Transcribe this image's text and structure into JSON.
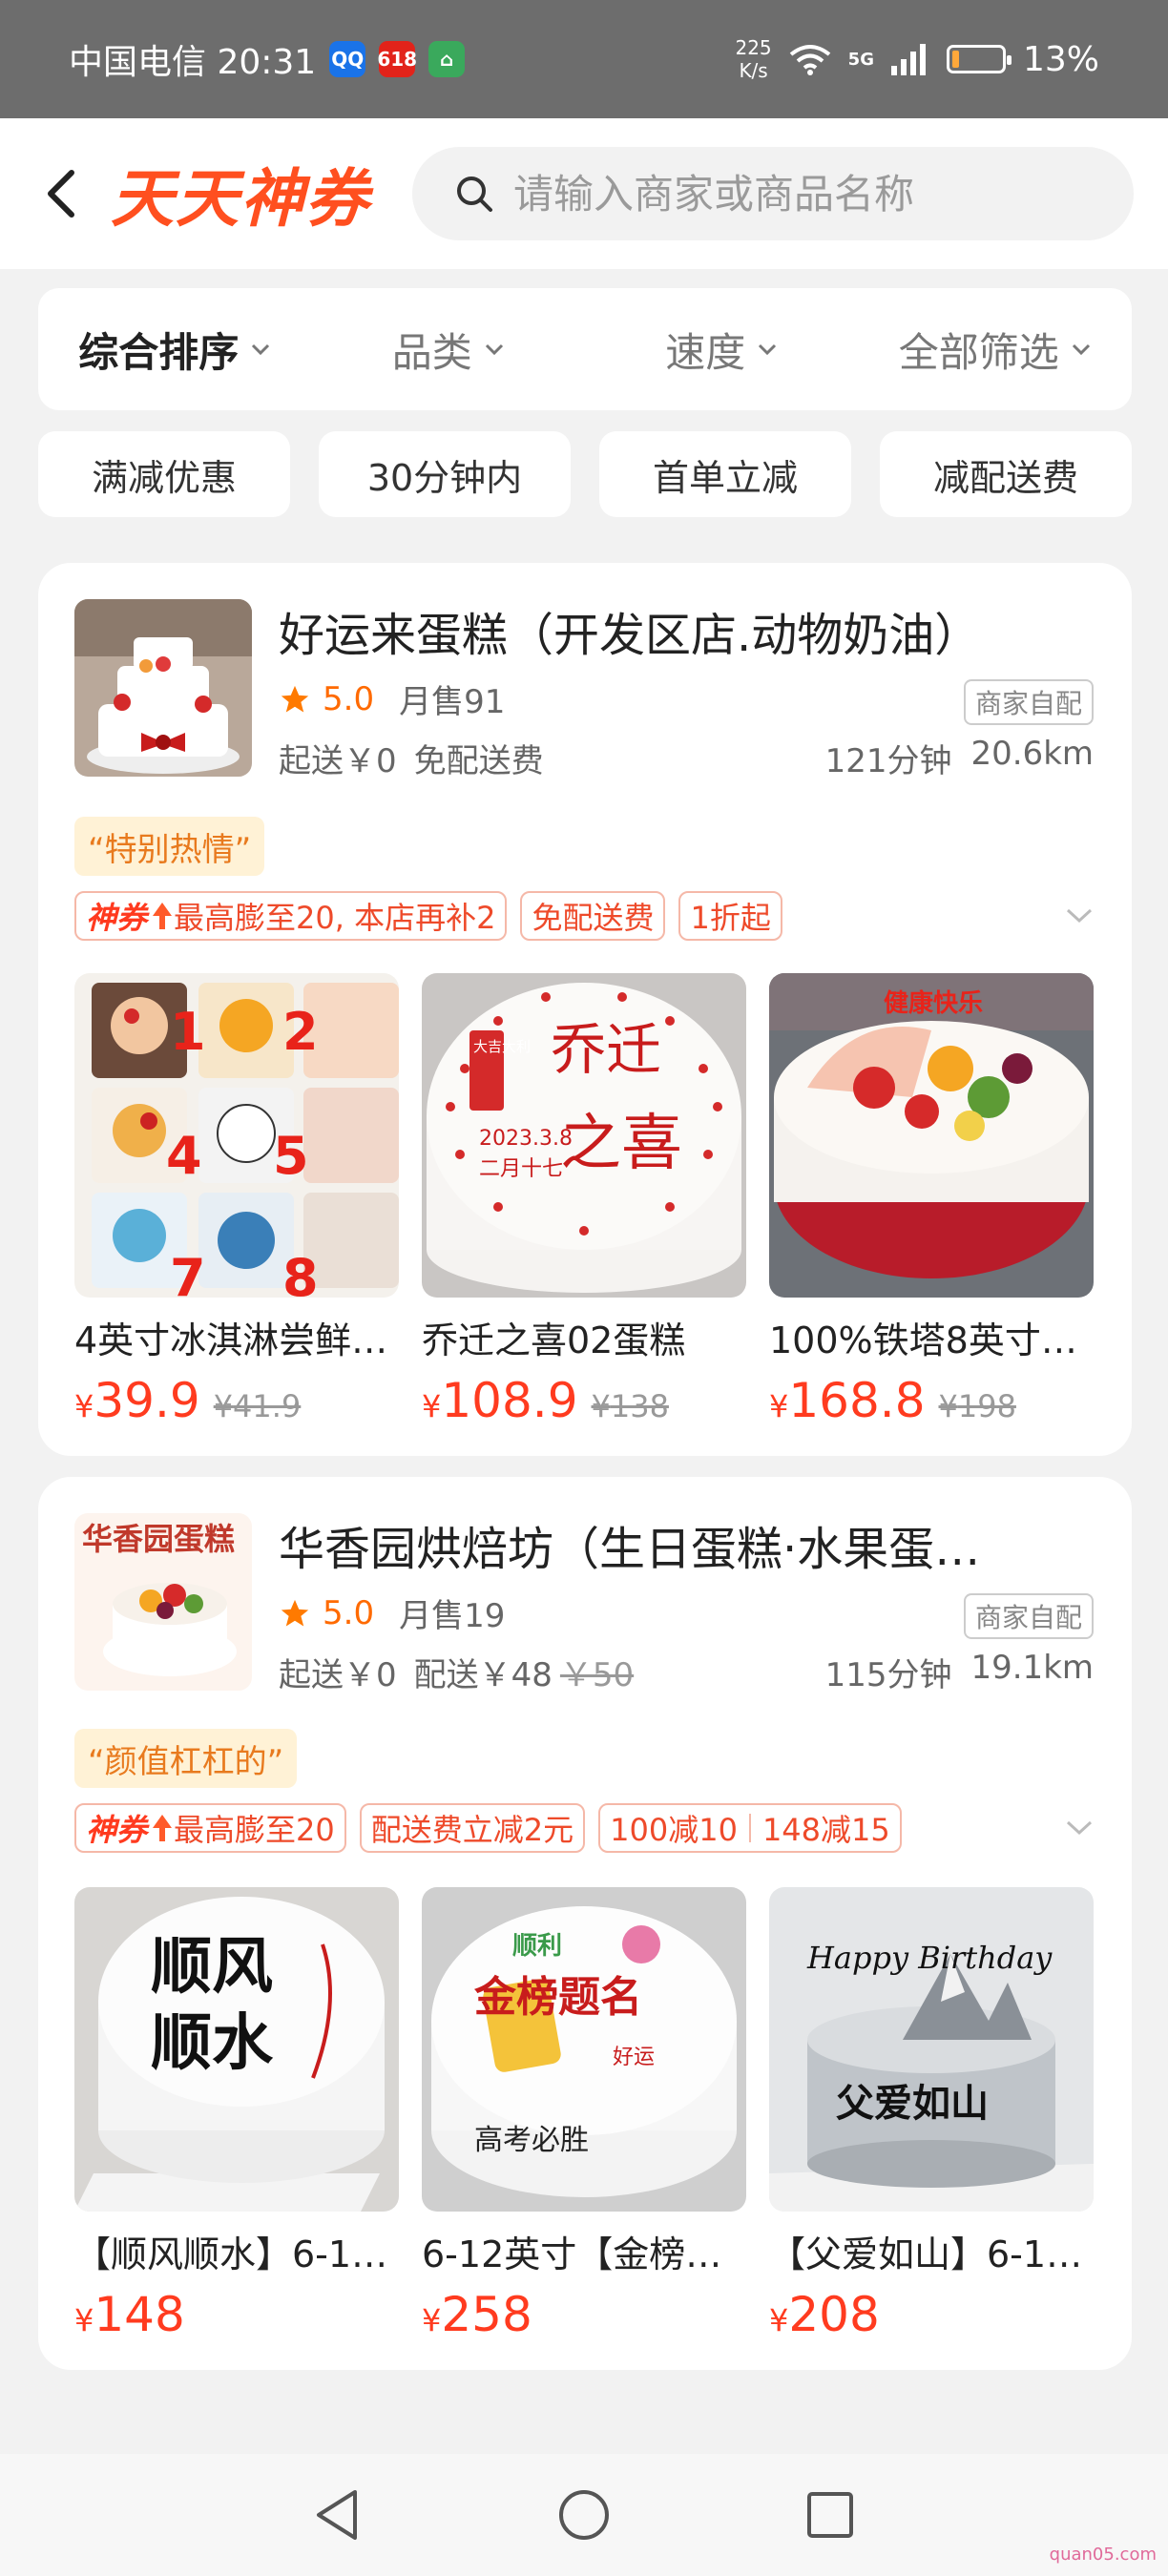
{
  "status": {
    "carrier_time": "中国电信 20:31",
    "net_speed": "225",
    "net_unit": "K/s",
    "network": "5G",
    "battery": "13%",
    "battery_level": 0.13,
    "app_icons": [
      "qq-icon",
      "taobao-618-icon",
      "home-app-icon"
    ],
    "app_icon_text": [
      "QQ",
      "618",
      "⌂"
    ]
  },
  "header": {
    "logo_text": "天天神券",
    "search_placeholder": "请输入商家或商品名称"
  },
  "sort_tabs": [
    {
      "label": "综合排序",
      "active": true
    },
    {
      "label": "品类",
      "active": false
    },
    {
      "label": "速度",
      "active": false
    },
    {
      "label": "全部筛选",
      "active": false
    }
  ],
  "filter_chips": [
    "满减优惠",
    "30分钟内",
    "首单立减",
    "减配送费"
  ],
  "shops": [
    {
      "name": "好运来蛋糕（开发区店.动物奶油）",
      "rating": "5.0",
      "sales": "月售91",
      "delivery_badge": "商家自配",
      "min_order": "起送￥0",
      "delivery_fee": "免配送费",
      "delivery_fee_old": "",
      "time": "121分钟",
      "distance": "20.6km",
      "review_tag": "“特别热情”",
      "promos": {
        "coupon_prefix": "神券",
        "coupon": "最高膨至20, 本店再补2",
        "tag2": "免配送费",
        "tag3": "1折起",
        "tag4": ""
      },
      "products": [
        {
          "name": "4英寸冰淇淋尝鲜…",
          "price": "39.9",
          "old_price": "41.9"
        },
        {
          "name": "乔迁之喜02蛋糕",
          "price": "108.9",
          "old_price": "138"
        },
        {
          "name": "100%铁塔8英寸…",
          "price": "168.8",
          "old_price": "198"
        }
      ],
      "image_texts": [
        "乔迁",
        "之喜",
        "大吉大利",
        "2023.3.8",
        "二月十七",
        "健康快乐"
      ]
    },
    {
      "name": "华香园烘焙坊（生日蛋糕·水果蛋…",
      "logo_text": "华香园蛋糕",
      "rating": "5.0",
      "sales": "月售19",
      "delivery_badge": "商家自配",
      "min_order": "起送￥0",
      "delivery_fee": "配送￥48",
      "delivery_fee_old": "￥50",
      "time": "115分钟",
      "distance": "19.1km",
      "review_tag": "“颜值杠杠的”",
      "promos": {
        "coupon_prefix": "神券",
        "coupon": "最高膨至20",
        "tag2": "配送费立减2元",
        "tag3": "100减10",
        "tag4": "148减15"
      },
      "products": [
        {
          "name": "【顺风顺水】6-1…",
          "price": "148",
          "old_price": ""
        },
        {
          "name": "6-12英寸【金榜…",
          "price": "258",
          "old_price": ""
        },
        {
          "name": "【父爱如山】6-1…",
          "price": "208",
          "old_price": ""
        }
      ],
      "image_texts": [
        "顺风",
        "顺水",
        "金榜题名",
        "顺利",
        "好运",
        "高考必胜",
        "Happy Birthday",
        "父爱如山"
      ]
    }
  ],
  "currency": "¥",
  "watermark": "quan05.com"
}
